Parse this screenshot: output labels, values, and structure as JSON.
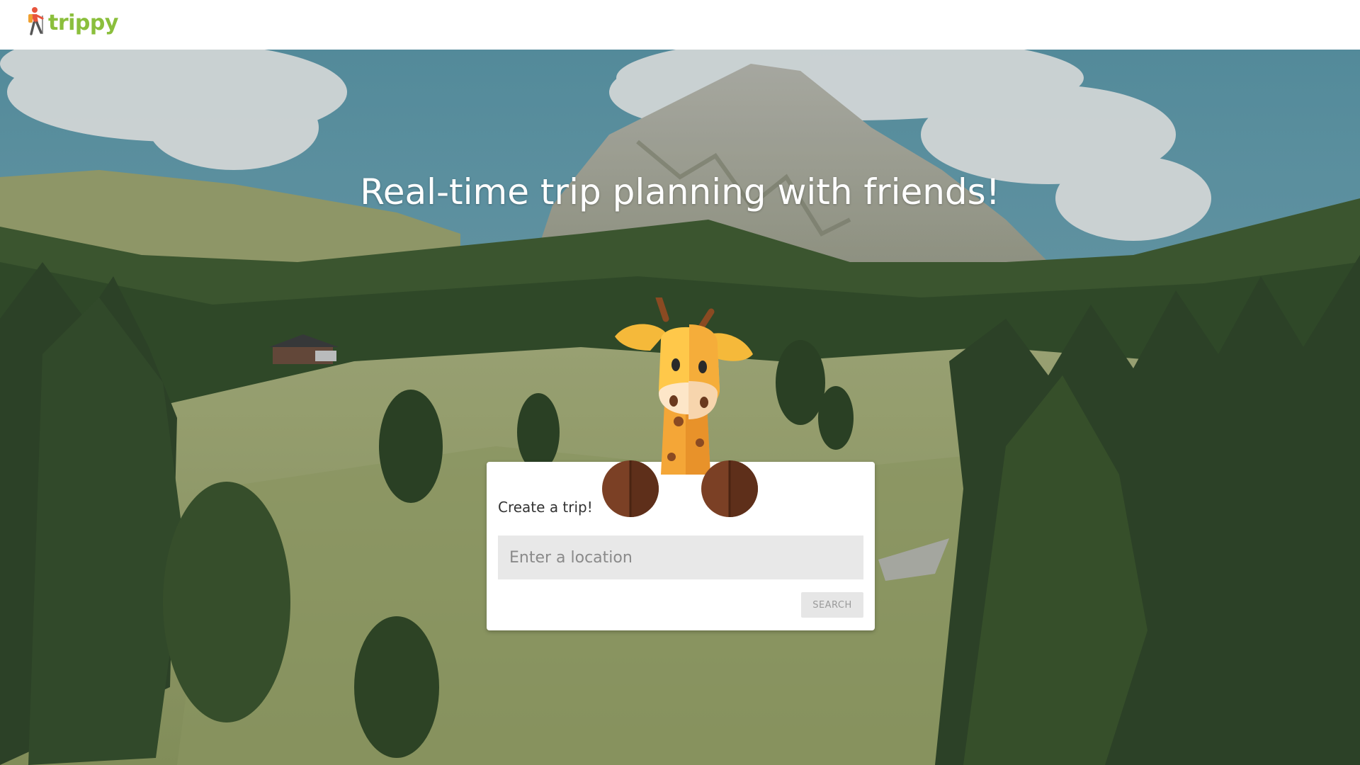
{
  "app": {
    "logo_text": "trippy",
    "logo_icon": "hiker-icon",
    "brand_color": "#8bbf3c"
  },
  "hero": {
    "headline": "Real-time trip planning with friends!",
    "background": "mountain-landscape"
  },
  "trip_card": {
    "title": "Create a trip!",
    "location_placeholder": "Enter a location",
    "location_value": "",
    "search_label": "SEARCH",
    "mascot": "giraffe-mascot"
  }
}
